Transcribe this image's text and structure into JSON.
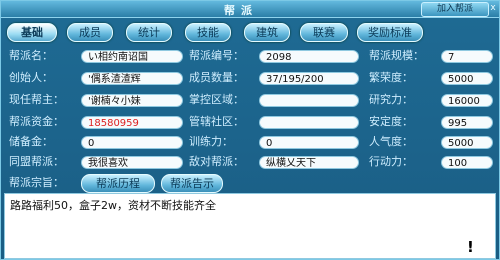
{
  "window": {
    "title": "帮派",
    "join_label": "加入帮派",
    "close_label": "x"
  },
  "tabs": [
    {
      "label": "基础",
      "active": true
    },
    {
      "label": "成员"
    },
    {
      "label": "统计"
    },
    {
      "label": "技能"
    },
    {
      "label": "建筑"
    },
    {
      "label": "联赛"
    },
    {
      "label": "奖励标准"
    }
  ],
  "info": {
    "name_label": "帮派名：",
    "name": "い相约南诏国",
    "founder_label": "创始人：",
    "founder": "'偶系渣渣辉",
    "leader_label": "现任帮主：",
    "leader": "'谢楠々小妹",
    "funds_label": "帮派资金：",
    "funds": "18580959",
    "reserve_label": "储备金：",
    "reserve": "0",
    "allied_label": "同盟帮派：",
    "allied": "我很喜欢",
    "id_label": "帮派编号：",
    "id": "2098",
    "members_label": "成员数量：",
    "members": "37/195/200",
    "region_label": "掌控区域：",
    "region": "",
    "community_label": "管辖社区：",
    "community": "",
    "training_label": "训练力：",
    "training": "0",
    "enemy_label": "敌对帮派：",
    "enemy": "纵横乂天下",
    "scale_label": "帮派规模：",
    "scale": "7",
    "prosperity_label": "繁荣度：",
    "prosperity": "5000",
    "research_label": "研究力：",
    "research": "16000",
    "stability_label": "安定度：",
    "stability": "995",
    "popularity_label": "人气度：",
    "popularity": "5000",
    "action_label": "行动力：",
    "action": "100"
  },
  "purpose": {
    "label": "帮派宗旨：",
    "history_button": "帮派历程",
    "notice_button": "帮派告示",
    "text": "路路福利50，盒子2w，资材不断技能齐全",
    "mark": "!"
  }
}
